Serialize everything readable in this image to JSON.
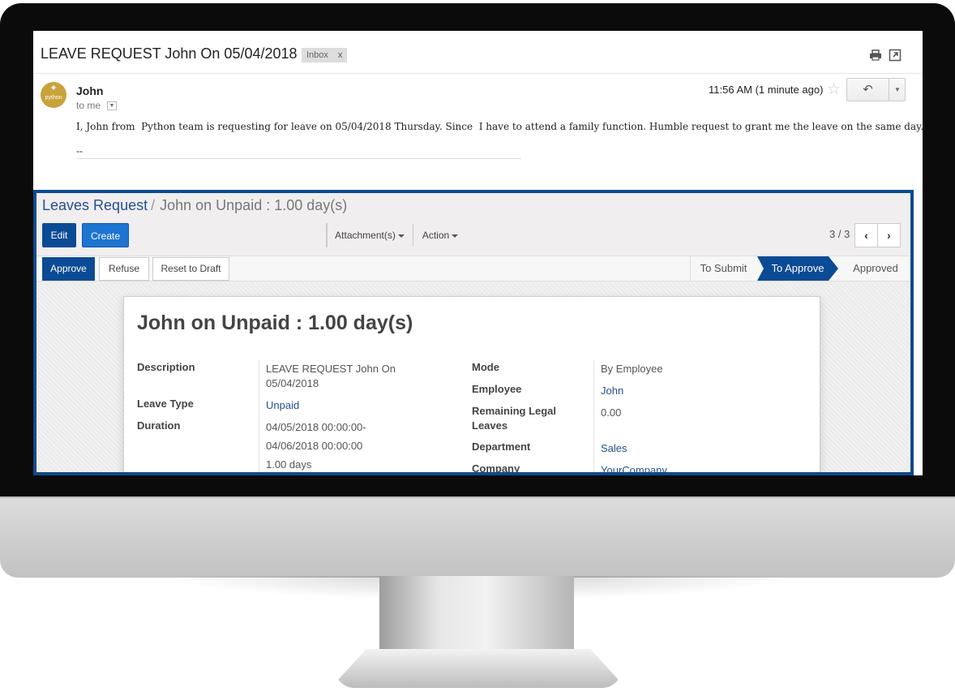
{
  "email": {
    "subject": "LEAVE REQUEST John On 05/04/2018",
    "label_badge": "Inbox",
    "label_remove": "x",
    "avatar_text": "python",
    "sender": "John",
    "recipient": "to me",
    "timestamp": "11:56 AM (1 minute ago)",
    "body": "I, John from  Python team is requesting for leave on 05/04/2018 Thursday. Since  I have to attend a family function. Humble request to grant me the leave on the same day.",
    "signature": "--"
  },
  "odoo": {
    "breadcrumb": {
      "parent": "Leaves Request",
      "separator": "/",
      "current": "John on Unpaid : 1.00 day(s)"
    },
    "toolbar": {
      "edit": "Edit",
      "create": "Create",
      "attachments": "Attachment(s)",
      "action": "Action",
      "pager": "3 / 3"
    },
    "statusbar": {
      "approve": "Approve",
      "refuse": "Refuse",
      "reset": "Reset to Draft",
      "stages": [
        "To Submit",
        "To Approve",
        "Approved"
      ],
      "active_stage": "To Approve"
    },
    "record": {
      "title": "John on Unpaid : 1.00 day(s)",
      "left_fields": [
        {
          "label": "Description",
          "value_lines": [
            "LEAVE REQUEST John On",
            "05/04/2018"
          ]
        },
        {
          "label": "Leave Type",
          "value": "Unpaid"
        },
        {
          "label": "Duration",
          "value_lines": [
            "04/05/2018 00:00:00-",
            "04/06/2018 00:00:00",
            "1.00 days"
          ]
        }
      ],
      "right_fields": [
        {
          "label": "Mode",
          "value": "By Employee"
        },
        {
          "label": "Employee",
          "value": "John"
        },
        {
          "label_lines": [
            "Remaining Legal",
            "Leaves"
          ],
          "value": "0.00"
        },
        {
          "label": "Department",
          "value": "Sales"
        },
        {
          "label": "Company",
          "value": "YourCompany"
        }
      ]
    }
  },
  "colors": {
    "odoo_primary": "#0b4b95",
    "odoo_link": "#24508f",
    "frame": "#0e4a8c"
  }
}
